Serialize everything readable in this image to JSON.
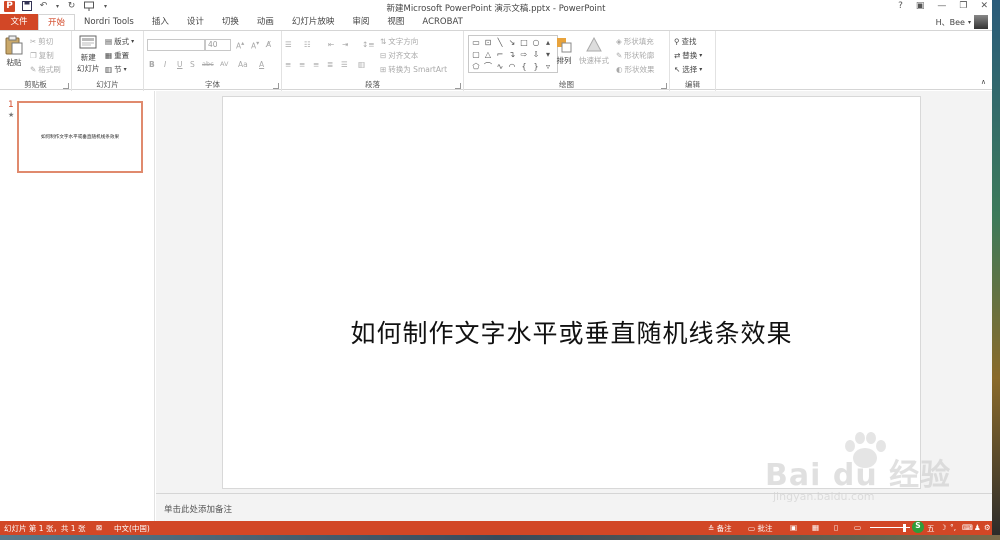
{
  "window": {
    "title": "新建Microsoft PowerPoint 演示文稿.pptx - PowerPoint",
    "controls": [
      "?",
      "▣",
      "—",
      "❐",
      "✕"
    ]
  },
  "user": {
    "name": "H、Bee"
  },
  "tabs": [
    "文件",
    "开始",
    "Nordri Tools",
    "插入",
    "设计",
    "切换",
    "动画",
    "幻灯片放映",
    "审阅",
    "视图",
    "ACROBAT"
  ],
  "active_tab": "开始",
  "ribbon": {
    "clipboard": {
      "label": "剪贴板",
      "paste": "粘贴",
      "cut": "剪切",
      "copy": "复制",
      "format_painter": "格式刷"
    },
    "slides": {
      "label": "幻灯片",
      "new_slide_line1": "新建",
      "new_slide_line2": "幻灯片",
      "layout": "版式",
      "reset": "重置",
      "section": "节"
    },
    "font": {
      "label": "字体",
      "size": "40",
      "bold": "B",
      "italic": "I",
      "underline": "U",
      "strike": "S",
      "shadow": "abc",
      "spacing": "AV",
      "case": "Aa",
      "color": "A"
    },
    "paragraph": {
      "label": "段落",
      "text_direction": "文字方向",
      "align_text": "对齐文本",
      "convert_smartart": "转换为 SmartArt"
    },
    "drawing": {
      "label": "绘图",
      "arrange": "排列",
      "quick_styles": "快速样式",
      "shape_fill": "形状填充",
      "shape_outline": "形状轮廓",
      "shape_effects": "形状效果"
    },
    "editing": {
      "label": "编辑",
      "find": "查找",
      "replace": "替换",
      "select": "选择"
    }
  },
  "thumbnail": {
    "number": "1",
    "star": "★",
    "text": "如何制作文字水平或垂直随机线条效果"
  },
  "slide": {
    "title": "如何制作文字水平或垂直随机线条效果"
  },
  "notes": {
    "placeholder": "单击此处添加备注"
  },
  "watermark": {
    "main": "Bai du 经验",
    "sub": "jingyan.baidu.com"
  },
  "status": {
    "slide_info": "幻灯片 第 1 张，共 1 张",
    "language": "中文(中国)",
    "notes_btn": "备注",
    "comments_btn": "批注",
    "ime": "五"
  },
  "colors": {
    "accent": "#d24726"
  }
}
